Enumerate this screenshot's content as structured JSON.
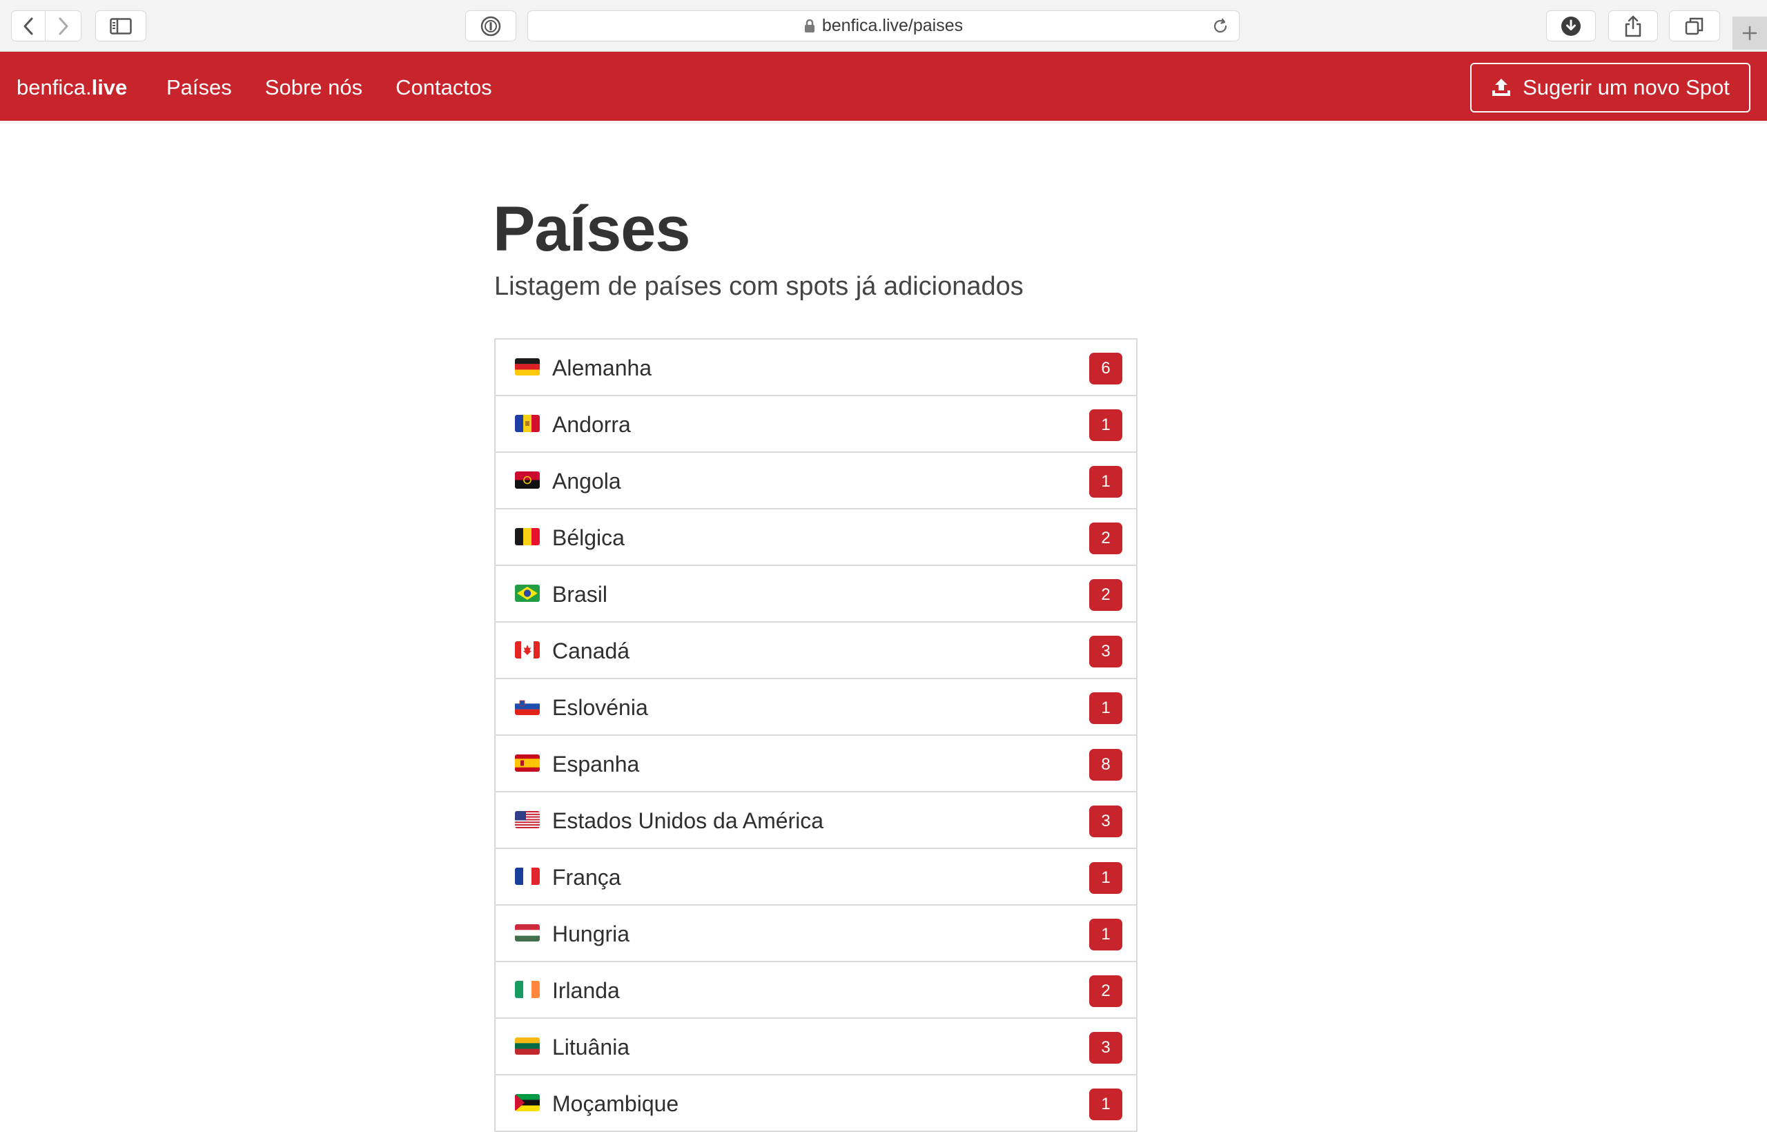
{
  "browser": {
    "url": "benfica.live/paises"
  },
  "navbar": {
    "brand_prefix": "benfica.",
    "brand_suffix": "live",
    "links": [
      "Países",
      "Sobre nós",
      "Contactos"
    ],
    "suggest_label": "Sugerir um novo Spot",
    "color": "#c8242c"
  },
  "page": {
    "title": "Países",
    "subtitle": "Listagem de países com spots já adicionados"
  },
  "countries": [
    {
      "name": "Alemanha",
      "count": "6",
      "flag": "germany-flag-icon"
    },
    {
      "name": "Andorra",
      "count": "1",
      "flag": "andorra-flag-icon"
    },
    {
      "name": "Angola",
      "count": "1",
      "flag": "angola-flag-icon"
    },
    {
      "name": "Bélgica",
      "count": "2",
      "flag": "belgium-flag-icon"
    },
    {
      "name": "Brasil",
      "count": "2",
      "flag": "brazil-flag-icon"
    },
    {
      "name": "Canadá",
      "count": "3",
      "flag": "canada-flag-icon"
    },
    {
      "name": "Eslovénia",
      "count": "1",
      "flag": "slovenia-flag-icon"
    },
    {
      "name": "Espanha",
      "count": "8",
      "flag": "spain-flag-icon"
    },
    {
      "name": "Estados Unidos da América",
      "count": "3",
      "flag": "usa-flag-icon"
    },
    {
      "name": "França",
      "count": "1",
      "flag": "france-flag-icon"
    },
    {
      "name": "Hungria",
      "count": "1",
      "flag": "hungary-flag-icon"
    },
    {
      "name": "Irlanda",
      "count": "2",
      "flag": "ireland-flag-icon"
    },
    {
      "name": "Lituânia",
      "count": "3",
      "flag": "lithuania-flag-icon"
    },
    {
      "name": "Moçambique",
      "count": "1",
      "flag": "mozambique-flag-icon"
    }
  ]
}
